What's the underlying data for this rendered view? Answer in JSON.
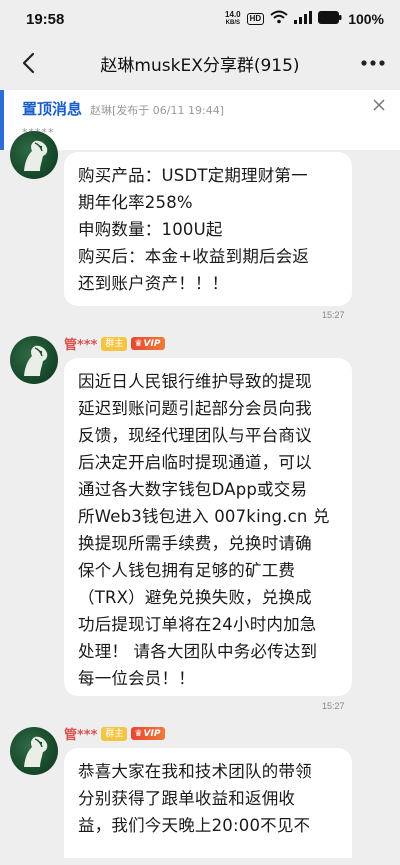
{
  "status_bar": {
    "time": "19:58",
    "net_speed": "14.0",
    "net_unit": "KB/S",
    "hd": "HD",
    "battery": "100%"
  },
  "header": {
    "title": "赵琳muskEX分享群(915)"
  },
  "pinned": {
    "label": "置顶消息",
    "meta": "赵琳[发布于 06/11 19:44]",
    "content": "*****"
  },
  "messages": [
    {
      "text": "购买产品：USDT定期理财第一\n期年化率258%\n申购数量：100U起\n购买后：本金+收益到期后会返\n还到账户资产！！！",
      "time": "15:27"
    },
    {
      "sender": "管***",
      "role": "群主",
      "vip": "VIP",
      "text": "因近日人民银行维护导致的提现\n延迟到账问题引起部分会员向我\n反馈，现经代理团队与平台商议\n后决定开启临时提现通道，可以\n通过各大数字钱包DApp或交易\n所Web3钱包进入 007king.cn 兑\n换提现所需手续费，兑换时请确\n保个人钱包拥有足够的矿工费\n（TRX）避免兑换失败，兑换成\n功后提现订单将在24小时内加急\n处理！ 请各大团队中务必传达到\n每一位会员！！",
      "time": "15:27"
    },
    {
      "sender": "管***",
      "role": "群主",
      "vip": "VIP",
      "text": "恭喜大家在我和技术团队的带领\n分别获得了跟单收益和返佣收\n益，我们今天晚上20:00不见不"
    }
  ]
}
